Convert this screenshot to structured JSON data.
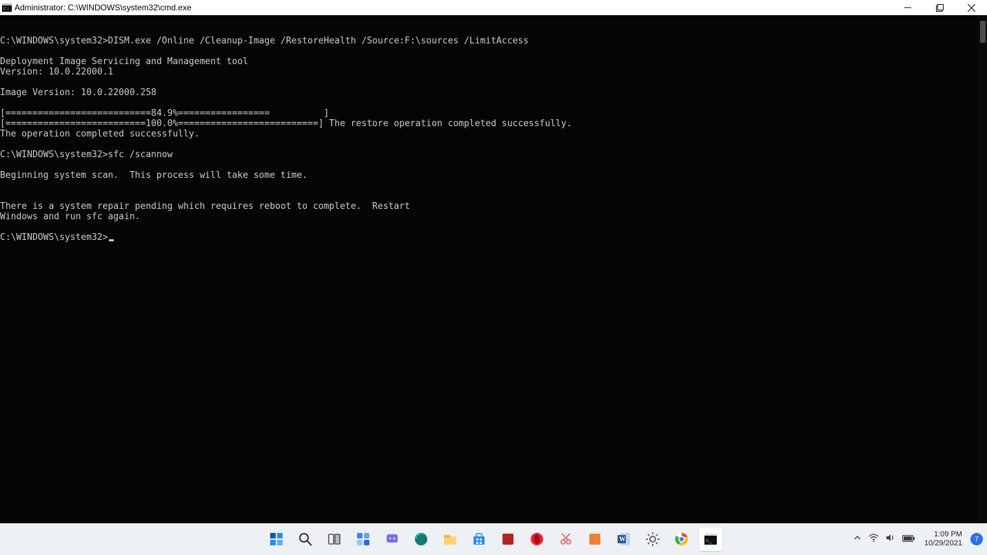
{
  "window": {
    "title": "Administrator: C:\\WINDOWS\\system32\\cmd.exe"
  },
  "terminal": {
    "lines": [
      "C:\\WINDOWS\\system32>DISM.exe /Online /Cleanup-Image /RestoreHealth /Source:F:\\sources /LimitAccess",
      "",
      "Deployment Image Servicing and Management tool",
      "Version: 10.0.22000.1",
      "",
      "Image Version: 10.0.22000.258",
      "",
      "[===========================84.9%=================          ]",
      "[==========================100.0%==========================] The restore operation completed successfully.",
      "The operation completed successfully.",
      "",
      "C:\\WINDOWS\\system32>sfc /scannow",
      "",
      "Beginning system scan.  This process will take some time.",
      "",
      "",
      "There is a system repair pending which requires reboot to complete.  Restart",
      "Windows and run sfc again.",
      "",
      "C:\\WINDOWS\\system32>"
    ]
  },
  "taskbar": {
    "items": [
      {
        "name": "start",
        "color": "#0078d4"
      },
      {
        "name": "search",
        "color": "#333"
      },
      {
        "name": "task-view",
        "color": "#555"
      },
      {
        "name": "widgets",
        "color": "#1f8fff"
      },
      {
        "name": "chat",
        "color": "#6f6fff"
      },
      {
        "name": "edge",
        "color": "#1f8fff"
      },
      {
        "name": "file-explorer",
        "color": "#f0b44c"
      },
      {
        "name": "microsoft-store",
        "color": "#1f8fff"
      },
      {
        "name": "app-red",
        "color": "#b52424"
      },
      {
        "name": "opera",
        "color": "#ff1b2d"
      },
      {
        "name": "snip",
        "color": "#e66a6a"
      },
      {
        "name": "app-orange",
        "color": "#f08030"
      },
      {
        "name": "word",
        "color": "#2b579a"
      },
      {
        "name": "settings",
        "color": "#6b6b6b"
      },
      {
        "name": "chrome",
        "color": "#f2b90f"
      },
      {
        "name": "cmd",
        "color": "#111",
        "active": true
      }
    ]
  },
  "tray": {
    "time": "1:09 PM",
    "date": "10/29/2021",
    "notif_count": "7"
  }
}
